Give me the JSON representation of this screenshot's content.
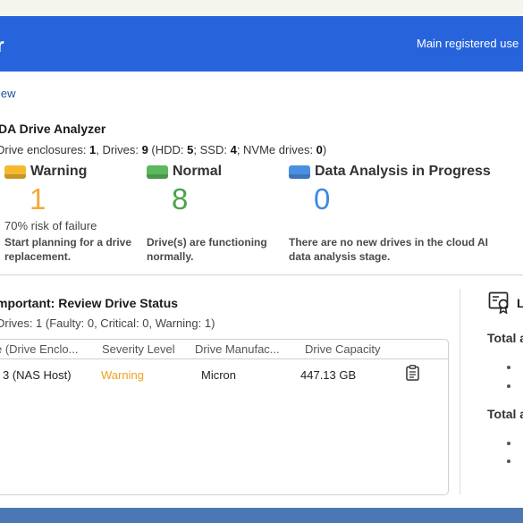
{
  "header": {
    "logo": "r",
    "registered_label": "Main registered use"
  },
  "breadcrumb": "iew",
  "title": "DA Drive Analyzer",
  "summary": {
    "enclosures_label": "Drive enclosures: ",
    "enclosures": "1",
    "drives_label": ", Drives: ",
    "drives": "9",
    "hdd_label": " (HDD: ",
    "hdd": "5",
    "ssd_label": "; SSD: ",
    "ssd": "4",
    "nvme_label": "; NVMe drives: ",
    "nvme": "0",
    "close": ")"
  },
  "stats": [
    {
      "label": "Warning",
      "value": "1",
      "color": "#f5b82e",
      "num_color": "#f3a93a",
      "desc": "Start planning for a drive replacement."
    },
    {
      "label": "Normal",
      "value": "8",
      "color": "#5cb85c",
      "num_color": "#49a34a",
      "desc": "Drive(s) are functioning normally."
    },
    {
      "label": "Data Analysis in Progress",
      "value": "0",
      "color": "#4a90e2",
      "num_color": "#3b8be0",
      "desc": "There are no new drives in the cloud AI data analysis stage."
    }
  ],
  "risk_text": "70% risk of failure",
  "important": {
    "title": "mportant: Review Drive Status",
    "subtitle": "Drives: 1 (Faulty: 0, Critical: 0, Warning: 1)",
    "columns": [
      "e (Drive Enclo...",
      "Severity Level",
      "Drive Manufac...",
      "Drive Capacity"
    ],
    "row": {
      "enclosure": "3 (NAS Host)",
      "severity": "Warning",
      "manufacturer": "Micron",
      "capacity": "447.13 GB"
    }
  },
  "side": {
    "letter": "L",
    "total_1": "Total a",
    "total_2": "Total a"
  }
}
